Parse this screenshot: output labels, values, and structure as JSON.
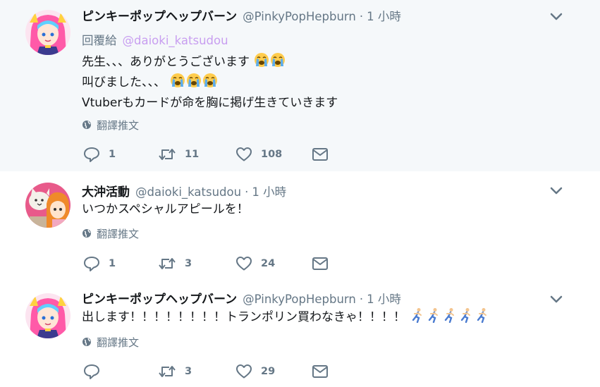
{
  "tweets": [
    {
      "name": "ピンキーポップヘップバーン",
      "handle": "@PinkyPopHepburn",
      "separator": "·",
      "time": "1 小時",
      "reply_prefix": "回覆給",
      "reply_to": "@daioki_katsudou",
      "lines": [
        {
          "text": "先生、、、ありがとうございます",
          "emoji": "crying-face",
          "emoji_count": 2
        },
        {
          "text": "叫びました、、、",
          "emoji": "crying-face",
          "emoji_count": 3
        },
        {
          "text": "Vtuberもカードが命を胸に掲げ生きていきます",
          "emoji": "",
          "emoji_count": 0
        }
      ],
      "translate_label": "翻譯推文",
      "counts": {
        "reply": "1",
        "retweet": "11",
        "like": "108"
      }
    },
    {
      "name": "大沖活動",
      "handle": "@daioki_katsudou",
      "separator": "·",
      "time": "1 小時",
      "lines": [
        {
          "text": "いつかスペシャルアピールを！",
          "emoji": "",
          "emoji_count": 0
        }
      ],
      "translate_label": "翻譯推文",
      "counts": {
        "reply": "1",
        "retweet": "3",
        "like": "24"
      }
    },
    {
      "name": "ピンキーポップヘップバーン",
      "handle": "@PinkyPopHepburn",
      "separator": "·",
      "time": "1 小時",
      "lines": [
        {
          "text": "出します！！！！！！！！トランポリン買わなきゃ！！！！",
          "emoji": "running-person",
          "emoji_count": 5
        }
      ],
      "translate_label": "翻譯推文",
      "counts": {
        "reply": "",
        "retweet": "3",
        "like": "29"
      }
    }
  ],
  "colors": {
    "highlight_bg": "#f5f8fa",
    "thread_line": "#e2d6f5",
    "reply_link": "#c89ef0",
    "secondary_text": "#657786",
    "icon": "#657786"
  },
  "icons": [
    "reply-icon",
    "retweet-icon",
    "like-icon",
    "direct-message-icon",
    "globe-icon",
    "chevron-down-icon",
    "crying-face-emoji",
    "running-person-emoji"
  ]
}
